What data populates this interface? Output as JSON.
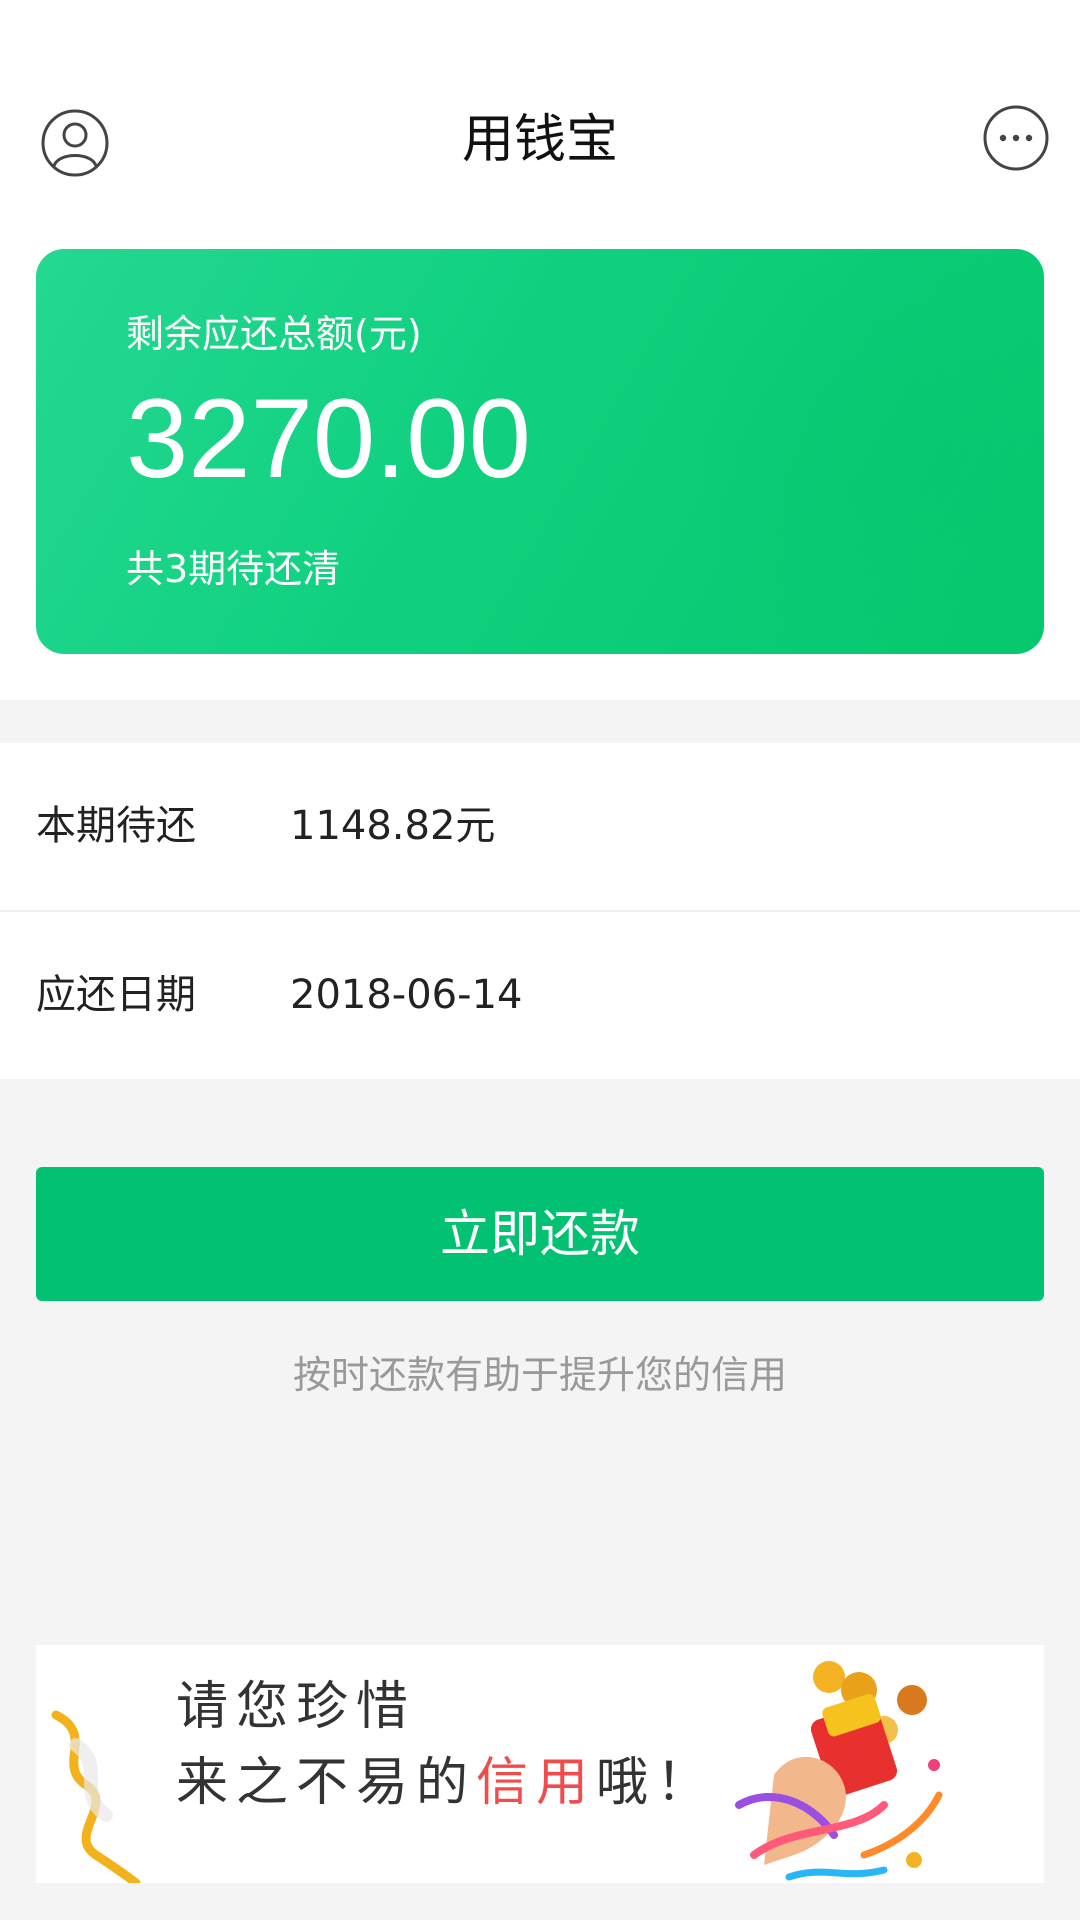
{
  "header": {
    "title": "用钱宝",
    "avatar_icon": "user-avatar-icon",
    "more_icon": "more-dots-icon"
  },
  "summary": {
    "label": "剩余应还总额(元)",
    "amount": "3270.00",
    "periods": "共3期待还清",
    "colors": {
      "gradient_start": "#24d891",
      "gradient_end": "#05c86d"
    }
  },
  "details": [
    {
      "key": "本期待还",
      "value": "1148.82元"
    },
    {
      "key": "应还日期",
      "value": "2018-06-14"
    }
  ],
  "repay_button": {
    "label": "立即还款",
    "color": "#03c172"
  },
  "hint": "按时还款有助于提升您的信用",
  "banner": {
    "line1": "请您珍惜",
    "line2_prefix": "来之不易的",
    "line2_highlight": "信用",
    "line2_suffix": "哦！",
    "highlight_color": "#f14c4c",
    "art_icon": "red-envelope-hand-icon"
  }
}
